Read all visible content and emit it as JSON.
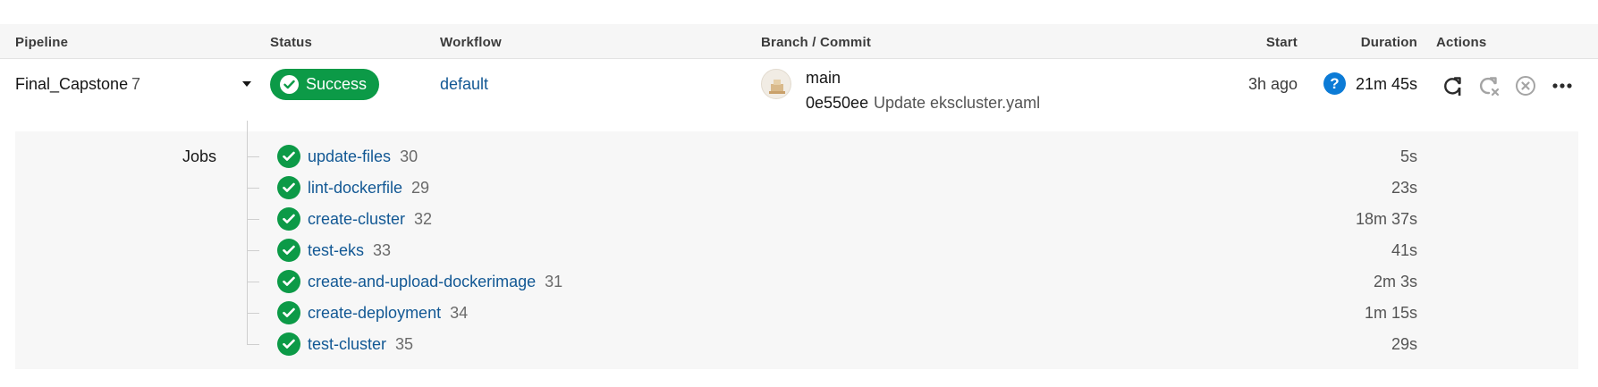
{
  "header": {
    "pipeline": "Pipeline",
    "status": "Status",
    "workflow": "Workflow",
    "branch_commit": "Branch / Commit",
    "start": "Start",
    "duration": "Duration",
    "actions": "Actions"
  },
  "pipeline": {
    "name": "Final_Capstone",
    "number": "7",
    "status": "Success",
    "workflow": "default",
    "branch": "main",
    "commit_hash": "0e550ee",
    "commit_message": "Update ekscluster.yaml",
    "start": "3h ago",
    "help": "?",
    "duration": "21m 45s"
  },
  "colors": {
    "success": "#0c9a47",
    "link": "#125894",
    "help": "#0c7bd6"
  },
  "icons": [
    "chevron-down-icon",
    "check-circle-icon",
    "rerun-icon",
    "rerun-failed-icon",
    "cancel-icon",
    "more-icon",
    "help-icon",
    "avatar-icon"
  ],
  "jobs": {
    "label": "Jobs",
    "items": [
      {
        "name": "update-files",
        "number": "30",
        "duration": "5s"
      },
      {
        "name": "lint-dockerfile",
        "number": "29",
        "duration": "23s"
      },
      {
        "name": "create-cluster",
        "number": "32",
        "duration": "18m 37s"
      },
      {
        "name": "test-eks",
        "number": "33",
        "duration": "41s"
      },
      {
        "name": "create-and-upload-dockerimage",
        "number": "31",
        "duration": "2m 3s"
      },
      {
        "name": "create-deployment",
        "number": "34",
        "duration": "1m 15s"
      },
      {
        "name": "test-cluster",
        "number": "35",
        "duration": "29s"
      }
    ]
  }
}
